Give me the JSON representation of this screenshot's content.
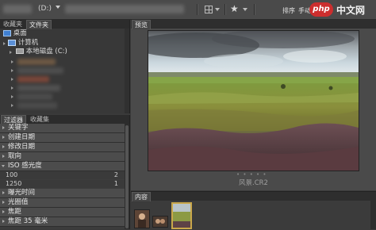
{
  "toolbar": {
    "drive": "(D:)",
    "sort_label": "排序",
    "manual_label": "手动",
    "star_icon": "star-icon",
    "watermark_badge": "php",
    "watermark_text": "中文网"
  },
  "left_top": {
    "tabs": [
      "收藏夹",
      "文件夹"
    ],
    "tree": [
      {
        "label": "桌面",
        "icon": "desktop-icon"
      },
      {
        "label": "计算机",
        "icon": "computer-icon"
      },
      {
        "label": "本地磁盘 (C:)",
        "icon": "drive-icon"
      }
    ]
  },
  "left_bottom": {
    "tabs": [
      "过滤器",
      "收藏集"
    ],
    "filters": [
      "关键字",
      "创建日期",
      "修改日期",
      "取向"
    ],
    "iso_label": "ISO 感光度",
    "iso_values": [
      {
        "value": "100",
        "count": "2"
      },
      {
        "value": "1250",
        "count": "1"
      }
    ],
    "filters_after": [
      "曝光时间",
      "光圈值",
      "焦距",
      "焦距 35 毫米"
    ]
  },
  "preview": {
    "tab": "预览",
    "caption": "风景.CR2"
  },
  "content": {
    "tab": "内容"
  }
}
